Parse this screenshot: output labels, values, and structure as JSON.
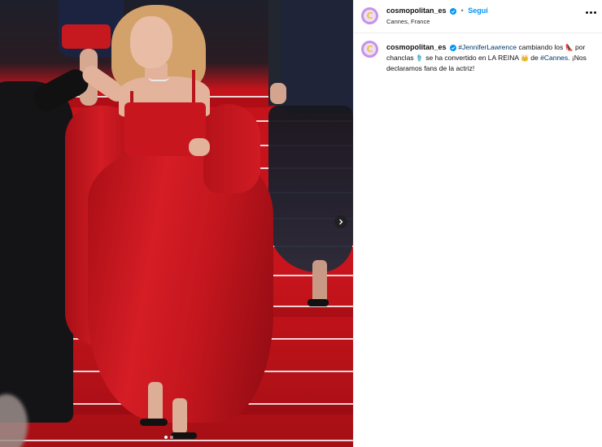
{
  "post": {
    "username": "cosmopolitan_es",
    "follow_label": "Seguí",
    "separator": "•",
    "location": "Cannes, France",
    "avatar_letter": "C",
    "colors": {
      "avatar_ring": "#c891e8",
      "avatar_letter": "#f2c230",
      "link": "#0095f6",
      "hashtag": "#00376b",
      "carpet": "#c8141c"
    }
  },
  "caption": {
    "username": "cosmopolitan_es",
    "mention": "#JenniferLawrence",
    "text_1": " cambiando los ",
    "emoji_1": "👠",
    "text_2": " por chanclas ",
    "emoji_2": "🩴",
    "text_3": " se ha convertido en LA REINA ",
    "emoji_3": "👑",
    "text_4": " de ",
    "hashtag": "#Cannes",
    "text_5": ". ¡Nos declaramos fans de la actriz!"
  },
  "carousel": {
    "slide_count": 2,
    "active_index": 0
  },
  "icons": {
    "next": "chevron-right-icon",
    "more": "more-options-icon",
    "verified": "verified-badge-icon"
  }
}
